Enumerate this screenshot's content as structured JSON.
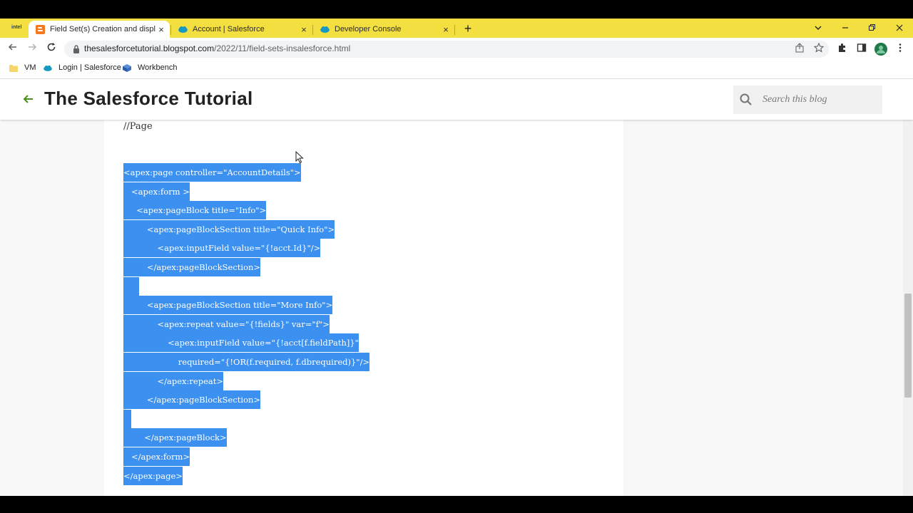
{
  "browser": {
    "tabs": [
      {
        "title": "Field Set(s) Creation and displayin",
        "icon": "blogger-icon",
        "active": true
      },
      {
        "title": "Account | Salesforce",
        "icon": "salesforce-cloud-icon",
        "active": false
      },
      {
        "title": "Developer Console",
        "icon": "salesforce-cloud-icon",
        "active": false
      }
    ],
    "intel_label": "intel",
    "close_glyph": "×",
    "new_tab_glyph": "+",
    "url_host": "thesalesforcetutorial.blogspot.com",
    "url_path": "/2022/11/field-sets-insalesforce.html",
    "bookmarks": [
      {
        "label": "VM",
        "icon": "folder-icon"
      },
      {
        "label": "Login | Salesforce",
        "icon": "salesforce-cloud-icon"
      },
      {
        "label": "Workbench",
        "icon": "workbench-cube-icon"
      }
    ]
  },
  "blog": {
    "title": "The Salesforce Tutorial",
    "search_placeholder": "Search this blog"
  },
  "post": {
    "section_label": "//Page",
    "code_lines": [
      "<apex:page controller=\"AccountDetails\">",
      "   <apex:form >",
      "     <apex:pageBlock title=\"Info\">",
      "         <apex:pageBlockSection title=\"Quick Info\">",
      "             <apex:inputField value=\"{!acct.Id}\"/>",
      "         </apex:pageBlockSection>",
      "      ",
      "         <apex:pageBlockSection title=\"More Info\">",
      "             <apex:repeat value=\"{!fields}\" var=\"f\">",
      "                 <apex:inputField value=\"{!acct[f.fieldPath]}\"",
      "                     required=\"{!OR(f.required, f.dbrequired)}\"/>",
      "             </apex:repeat>",
      "         </apex:pageBlockSection>",
      "   ",
      "        </apex:pageBlock>",
      "   </apex:form>",
      "</apex:page>"
    ]
  },
  "colors": {
    "tabstrip": "#f3df3f",
    "selection": "#3c90ef",
    "back_arrow": "#4a8f1c"
  }
}
